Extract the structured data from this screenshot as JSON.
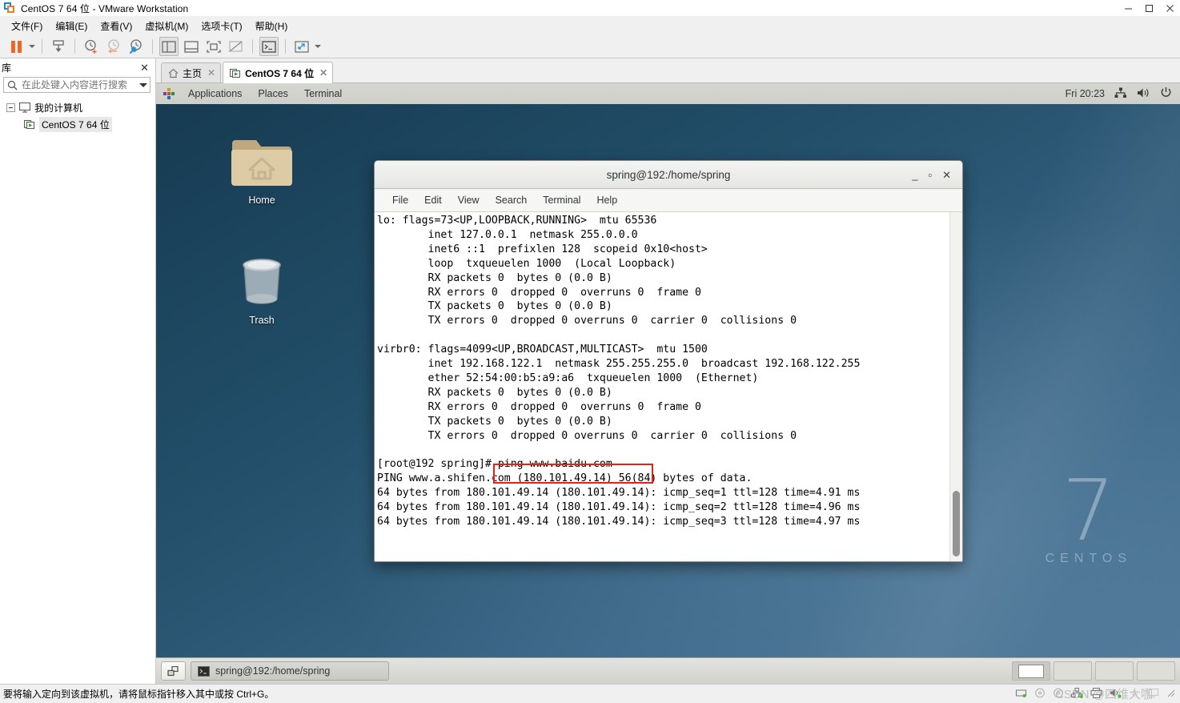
{
  "window": {
    "title": "CentOS 7 64 位 - VMware Workstation",
    "minimize": "—",
    "maximize": "▢",
    "close": "✕"
  },
  "menubar": {
    "items": [
      {
        "label": "文件(F)",
        "accel": "F"
      },
      {
        "label": "编辑(E)",
        "accel": "E"
      },
      {
        "label": "查看(V)",
        "accel": "V"
      },
      {
        "label": "虚拟机(M)",
        "accel": "M"
      },
      {
        "label": "选项卡(T)",
        "accel": "T"
      },
      {
        "label": "帮助(H)",
        "accel": "H"
      }
    ]
  },
  "toolbar": {
    "icons": [
      {
        "name": "pause-vm-icon"
      },
      {
        "name": "pause-dropdown-caret"
      },
      {
        "name": "send-ctrl-alt-del-icon"
      },
      {
        "name": "snapshot-take-icon"
      },
      {
        "name": "snapshot-revert-icon"
      },
      {
        "name": "snapshot-manager-icon"
      },
      {
        "name": "show-library-icon"
      },
      {
        "name": "show-thumbnail-bar-icon"
      },
      {
        "name": "full-screen-icon"
      },
      {
        "name": "unity-mode-icon"
      },
      {
        "name": "console-view-icon"
      },
      {
        "name": "stretch-view-icon"
      },
      {
        "name": "stretch-dropdown-caret"
      }
    ]
  },
  "sidebar": {
    "header_title": "库",
    "close_label": "✕",
    "search_placeholder": "在此处键入内容进行搜索",
    "search_value": "",
    "tree": [
      {
        "label": "我的计算机",
        "icon": "computer-icon",
        "level": 0
      },
      {
        "label": "CentOS 7 64 位",
        "icon": "vm-running-icon",
        "level": 1
      }
    ]
  },
  "tabs": [
    {
      "label": "主页",
      "icon": "home-icon",
      "active": false,
      "close": "✕"
    },
    {
      "label": "CentOS 7 64 位",
      "icon": "vm-running-icon",
      "active": true,
      "close": "✕"
    }
  ],
  "guest": {
    "topbar": {
      "menus": [
        "Applications",
        "Places",
        "Terminal"
      ],
      "clock": "Fri 20:23",
      "tray": [
        "network-icon",
        "volume-icon",
        "power-icon"
      ]
    },
    "desktop_icons": [
      {
        "label": "Home",
        "icon": "home-folder-icon"
      },
      {
        "label": "Trash",
        "icon": "trash-icon"
      }
    ],
    "watermark": {
      "number": "7",
      "word": "CENTOS"
    },
    "taskbar": {
      "show_desktop": "show-desktop-icon",
      "window_title": "spring@192:/home/spring",
      "window_icon": "terminal-icon",
      "workspaces": 4,
      "active_workspace": 1
    }
  },
  "terminal": {
    "title": "spring@192:/home/spring",
    "controls": {
      "minimize": "_",
      "maximize": "▫",
      "close": "✕"
    },
    "menus": [
      {
        "label": "File",
        "accel": "F"
      },
      {
        "label": "Edit",
        "accel": "E"
      },
      {
        "label": "View",
        "accel": "V"
      },
      {
        "label": "Search",
        "accel": "S"
      },
      {
        "label": "Terminal",
        "accel": "T"
      },
      {
        "label": "Help",
        "accel": "H"
      }
    ],
    "output": "lo: flags=73<UP,LOOPBACK,RUNNING>  mtu 65536\n        inet 127.0.0.1  netmask 255.0.0.0\n        inet6 ::1  prefixlen 128  scopeid 0x10<host>\n        loop  txqueuelen 1000  (Local Loopback)\n        RX packets 0  bytes 0 (0.0 B)\n        RX errors 0  dropped 0  overruns 0  frame 0\n        TX packets 0  bytes 0 (0.0 B)\n        TX errors 0  dropped 0 overruns 0  carrier 0  collisions 0\n\nvirbr0: flags=4099<UP,BROADCAST,MULTICAST>  mtu 1500\n        inet 192.168.122.1  netmask 255.255.255.0  broadcast 192.168.122.255\n        ether 52:54:00:b5:a9:a6  txqueuelen 1000  (Ethernet)\n        RX packets 0  bytes 0 (0.0 B)\n        RX errors 0  dropped 0  overruns 0  frame 0\n        TX packets 0  bytes 0 (0.0 B)\n        TX errors 0  dropped 0 overruns 0  carrier 0  collisions 0\n\n[root@192 spring]# ping www.baidu.com\nPING www.a.shifen.com (180.101.49.14) 56(84) bytes of data.\n64 bytes from 180.101.49.14 (180.101.49.14): icmp_seq=1 ttl=128 time=4.91 ms\n64 bytes from 180.101.49.14 (180.101.49.14): icmp_seq=2 ttl=128 time=4.96 ms\n64 bytes from 180.101.49.14 (180.101.49.14): icmp_seq=3 ttl=128 time=4.97 ms",
    "highlight_command": "# ping www.baidu.com",
    "highlight_color": "#e8201a"
  },
  "statusbar": {
    "hint": "要将输入定向到该虚拟机，请将鼠标指针移入其中或按 Ctrl+G。",
    "devices": [
      "hard-disk-icon",
      "cd-drive-icon",
      "cd-drive-2-icon",
      "network-adapter-icon",
      "printer-icon",
      "sound-card-icon",
      "usb-icon",
      "display-icon"
    ],
    "watermark": "CSDN @四维大咖"
  }
}
